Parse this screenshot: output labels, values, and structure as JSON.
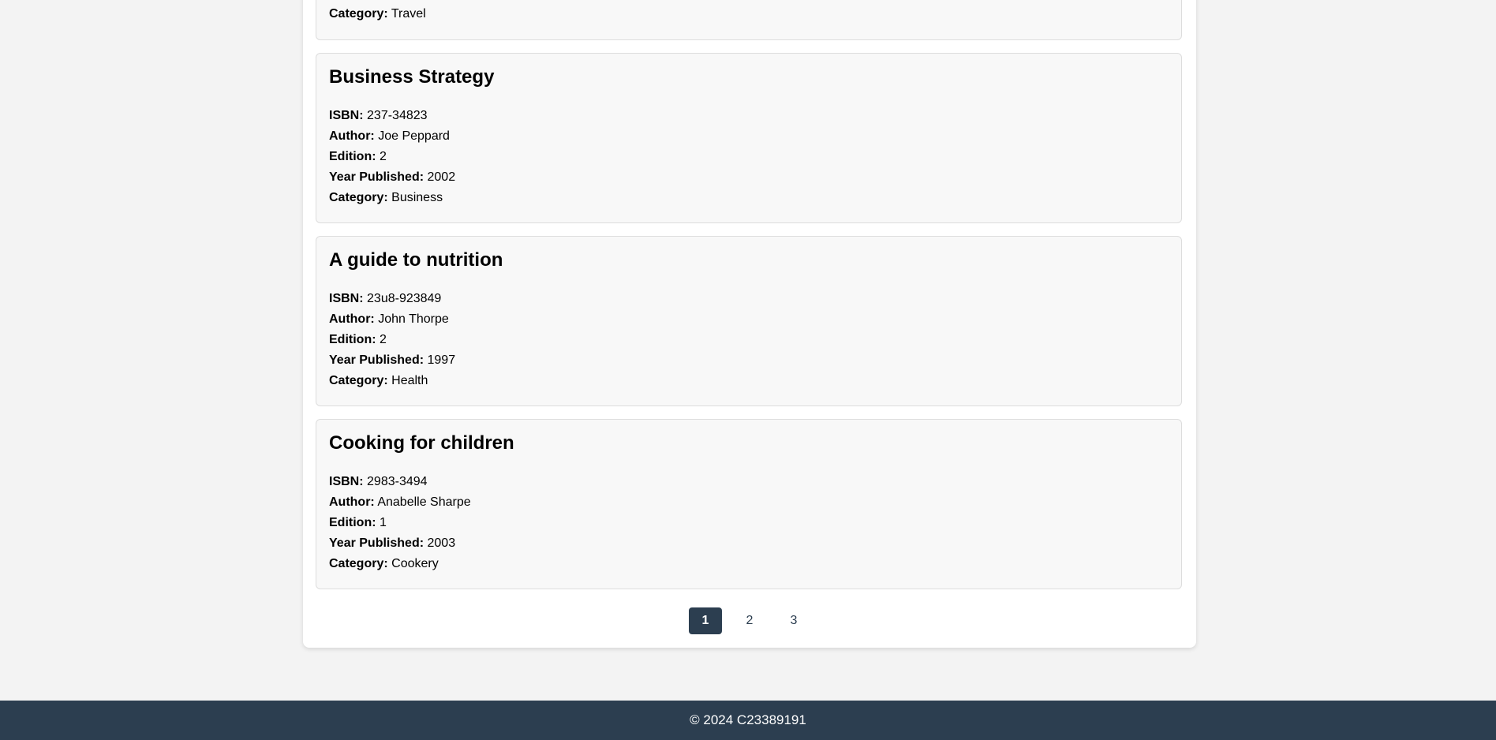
{
  "books": [
    {
      "title": "",
      "fields": [
        {
          "label": "Category:",
          "value": "Travel"
        }
      ]
    },
    {
      "title": "Business Strategy",
      "fields": [
        {
          "label": "ISBN:",
          "value": "237-34823"
        },
        {
          "label": "Author:",
          "value": "Joe Peppard"
        },
        {
          "label": "Edition:",
          "value": "2"
        },
        {
          "label": "Year Published:",
          "value": "2002"
        },
        {
          "label": "Category:",
          "value": "Business"
        }
      ]
    },
    {
      "title": "A guide to nutrition",
      "fields": [
        {
          "label": "ISBN:",
          "value": "23u8-923849"
        },
        {
          "label": "Author:",
          "value": "John Thorpe"
        },
        {
          "label": "Edition:",
          "value": "2"
        },
        {
          "label": "Year Published:",
          "value": "1997"
        },
        {
          "label": "Category:",
          "value": "Health"
        }
      ]
    },
    {
      "title": "Cooking for children",
      "fields": [
        {
          "label": "ISBN:",
          "value": "2983-3494"
        },
        {
          "label": "Author:",
          "value": "Anabelle Sharpe"
        },
        {
          "label": "Edition:",
          "value": "1"
        },
        {
          "label": "Year Published:",
          "value": "2003"
        },
        {
          "label": "Category:",
          "value": "Cookery"
        }
      ]
    }
  ],
  "pagination": {
    "pages": [
      "1",
      "2",
      "3"
    ],
    "active": "1"
  },
  "footer": {
    "text": "© 2024 C23389191"
  },
  "colors": {
    "accent": "#2c3e50",
    "background": "#f3f3f3",
    "card": "#f8f8f8"
  }
}
